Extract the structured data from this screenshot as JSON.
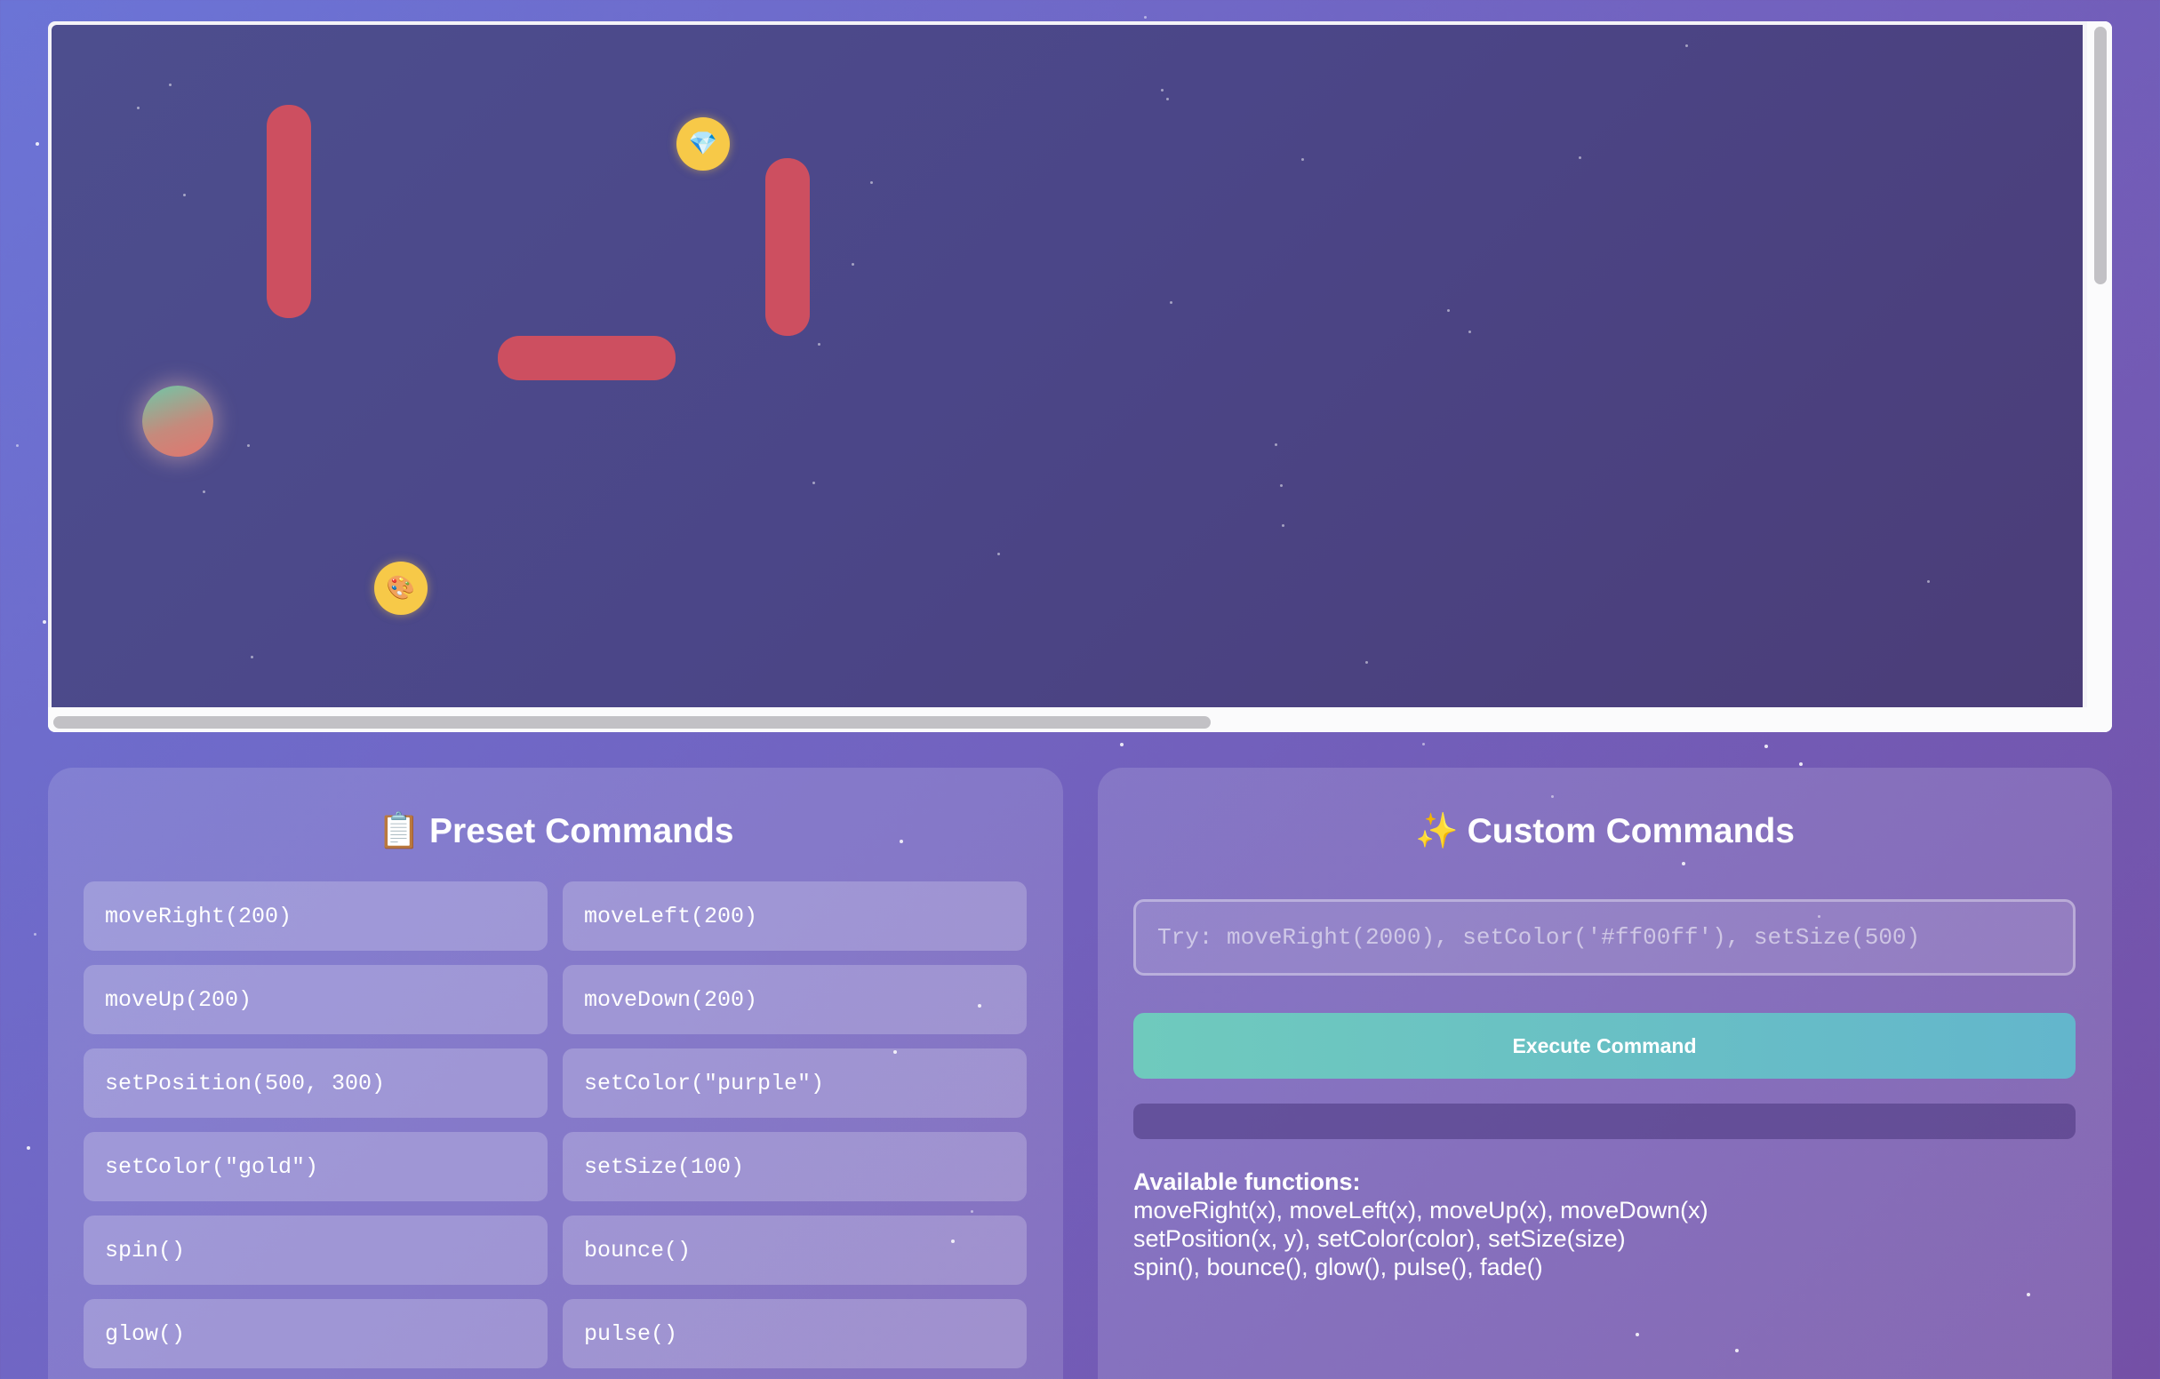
{
  "game": {
    "pickups": [
      {
        "icon": "gem",
        "glyph": "💎"
      },
      {
        "icon": "palette",
        "glyph": "🎨"
      }
    ]
  },
  "presets": {
    "title_icon": "📋",
    "title": "Preset Commands",
    "commands": [
      "moveRight(200)",
      "moveLeft(200)",
      "moveUp(200)",
      "moveDown(200)",
      "setPosition(500, 300)",
      "setColor(\"purple\")",
      "setColor(\"gold\")",
      "setSize(100)",
      "spin()",
      "bounce()",
      "glow()",
      "pulse()"
    ]
  },
  "custom": {
    "title_icon": "✨",
    "title": "Custom Commands",
    "placeholder": "Try: moveRight(2000), setColor('#ff00ff'), setSize(500)",
    "execute_label": "Execute Command",
    "output": "",
    "help_title": "Available functions:",
    "help_lines": [
      "moveRight(x), moveLeft(x), moveUp(x), moveDown(x)",
      "setPosition(x, y), setColor(color), setSize(size)",
      "spin(), bounce(), glow(), pulse(), fade()"
    ]
  },
  "colors": {
    "wall": "#cd4f60",
    "pickup": "#f7c948",
    "execute_gradient_start": "#6fcabd",
    "execute_gradient_end": "#63b6cc"
  }
}
